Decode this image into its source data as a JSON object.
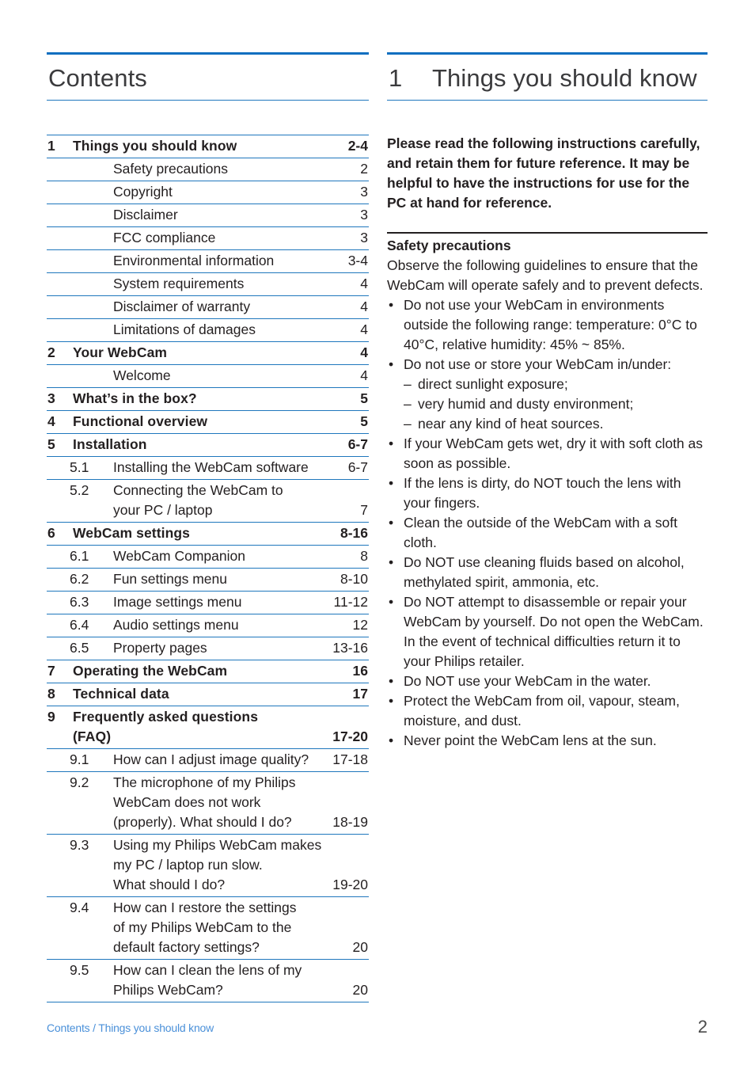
{
  "colors": {
    "rule_blue": "#0f6fc0",
    "rule_thin_blue": "#1f77bd",
    "text": "#231f20",
    "footer_link": "#4a90d9",
    "footer_page": "#4a4a4a"
  },
  "left_column": {
    "heading": "Contents",
    "toc": [
      {
        "level": 1,
        "num": "1",
        "lines": [
          {
            "text": "Things you should know",
            "page": "2-4"
          }
        ]
      },
      {
        "level": 2,
        "num": "",
        "lines": [
          {
            "text": "Safety precautions",
            "page": "2"
          }
        ]
      },
      {
        "level": 2,
        "num": "",
        "lines": [
          {
            "text": "Copyright",
            "page": "3"
          }
        ]
      },
      {
        "level": 2,
        "num": "",
        "lines": [
          {
            "text": "Disclaimer",
            "page": "3"
          }
        ]
      },
      {
        "level": 2,
        "num": "",
        "lines": [
          {
            "text": "FCC compliance",
            "page": "3"
          }
        ]
      },
      {
        "level": 2,
        "num": "",
        "lines": [
          {
            "text": "Environmental information",
            "page": "3-4"
          }
        ]
      },
      {
        "level": 2,
        "num": "",
        "lines": [
          {
            "text": "System requirements",
            "page": "4"
          }
        ]
      },
      {
        "level": 2,
        "num": "",
        "lines": [
          {
            "text": "Disclaimer of warranty",
            "page": "4"
          }
        ]
      },
      {
        "level": 2,
        "num": "",
        "lines": [
          {
            "text": "Limitations of damages",
            "page": "4"
          }
        ]
      },
      {
        "level": 1,
        "num": "2",
        "lines": [
          {
            "text": "Your WebCam",
            "page": "4"
          }
        ]
      },
      {
        "level": 2,
        "num": "",
        "lines": [
          {
            "text": "Welcome",
            "page": "4"
          }
        ]
      },
      {
        "level": 1,
        "num": "3",
        "lines": [
          {
            "text": "What’s in the box?",
            "page": "5"
          }
        ]
      },
      {
        "level": 1,
        "num": "4",
        "lines": [
          {
            "text": "Functional overview",
            "page": "5"
          }
        ]
      },
      {
        "level": 1,
        "num": "5",
        "lines": [
          {
            "text": "Installation",
            "page": "6-7"
          }
        ]
      },
      {
        "level": 3,
        "num": "5.1",
        "lines": [
          {
            "text": "Installing the WebCam software",
            "page": "6-7"
          }
        ]
      },
      {
        "level": 3,
        "num": "5.2",
        "lines": [
          {
            "text": "Connecting the WebCam to",
            "page": ""
          },
          {
            "text": "your PC / laptop",
            "page": "7"
          }
        ]
      },
      {
        "level": 1,
        "num": "6",
        "lines": [
          {
            "text": "WebCam settings",
            "page": "8-16"
          }
        ]
      },
      {
        "level": 3,
        "num": "6.1",
        "lines": [
          {
            "text": "WebCam Companion",
            "page": "8"
          }
        ]
      },
      {
        "level": 3,
        "num": "6.2",
        "lines": [
          {
            "text": "Fun settings menu",
            "page": "8-10"
          }
        ]
      },
      {
        "level": 3,
        "num": "6.3",
        "lines": [
          {
            "text": "Image settings menu",
            "page": "11-12"
          }
        ]
      },
      {
        "level": 3,
        "num": "6.4",
        "lines": [
          {
            "text": "Audio settings menu",
            "page": "12"
          }
        ]
      },
      {
        "level": 3,
        "num": "6.5",
        "lines": [
          {
            "text": "Property pages",
            "page": "13-16"
          }
        ]
      },
      {
        "level": 1,
        "num": "7",
        "lines": [
          {
            "text": "Operating the WebCam",
            "page": "16"
          }
        ]
      },
      {
        "level": 1,
        "num": "8",
        "lines": [
          {
            "text": "Technical data",
            "page": "17"
          }
        ]
      },
      {
        "level": 1,
        "num": "9",
        "lines": [
          {
            "text": "Frequently asked questions",
            "page": ""
          },
          {
            "text": "(FAQ)",
            "page": "17-20"
          }
        ]
      },
      {
        "level": 3,
        "num": "9.1",
        "lines": [
          {
            "text": "How can I adjust image quality?",
            "page": "17-18"
          }
        ]
      },
      {
        "level": 3,
        "num": "9.2",
        "lines": [
          {
            "text": "The microphone of my Philips",
            "page": ""
          },
          {
            "text": "WebCam does not work",
            "page": ""
          },
          {
            "text": "(properly). What should I do?",
            "page": "18-19"
          }
        ]
      },
      {
        "level": 3,
        "num": "9.3",
        "lines": [
          {
            "text": "Using my Philips WebCam makes",
            "page": ""
          },
          {
            "text": "my PC / laptop run slow.",
            "page": ""
          },
          {
            "text": "What should I do?",
            "page": "19-20"
          }
        ]
      },
      {
        "level": 3,
        "num": "9.4",
        "lines": [
          {
            "text": "How can I restore the settings",
            "page": ""
          },
          {
            "text": "of my Philips WebCam to the",
            "page": ""
          },
          {
            "text": "default factory settings?",
            "page": "20"
          }
        ]
      },
      {
        "level": 3,
        "num": "9.5",
        "lines": [
          {
            "text": "How can I clean the lens of my",
            "page": ""
          },
          {
            "text": "Philips WebCam?",
            "page": "20"
          }
        ]
      }
    ]
  },
  "right_column": {
    "chapter_number": "1",
    "chapter_title": "Things you should know",
    "intro": "Please read the following instructions carefully, and retain them for future reference. It may be helpful to have the instructions for use for the PC at hand for reference.",
    "section_title": "Safety precautions",
    "section_intro": "Observe the following guidelines to ensure that the WebCam will operate safely and to prevent defects.",
    "bullet_char": "•",
    "dash_char": "–",
    "bullets": [
      {
        "text": "Do not use your WebCam in environments outside the following range: temperature: 0°C to 40°C, relative humidity: 45% ~ 85%.",
        "sub": []
      },
      {
        "text": "Do not use or store your WebCam in/under:",
        "sub": [
          "direct sunlight exposure;",
          "very humid and dusty environment;",
          "near any kind of heat sources."
        ]
      },
      {
        "text": "If your WebCam gets wet, dry it with soft cloth as soon as possible.",
        "sub": []
      },
      {
        "text": "If the lens is dirty, do NOT touch the lens with your fingers.",
        "sub": []
      },
      {
        "text": "Clean the outside of the WebCam with a soft cloth.",
        "sub": []
      },
      {
        "text": "Do NOT use cleaning fluids based on alcohol, methylated spirit, ammonia, etc.",
        "sub": []
      },
      {
        "text": "Do NOT attempt to disassemble or repair your WebCam by yourself. Do not open the WebCam. In the event of technical difficulties return it to your Philips retailer.",
        "sub": []
      },
      {
        "text": "Do NOT use your WebCam in the water.",
        "sub": []
      },
      {
        "text": "Protect the WebCam from oil, vapour, steam, moisture, and dust.",
        "sub": []
      },
      {
        "text": "Never point the WebCam lens at the sun.",
        "sub": []
      }
    ]
  },
  "footer": {
    "breadcrumb": "Contents / Things you should know",
    "page_number": "2"
  }
}
